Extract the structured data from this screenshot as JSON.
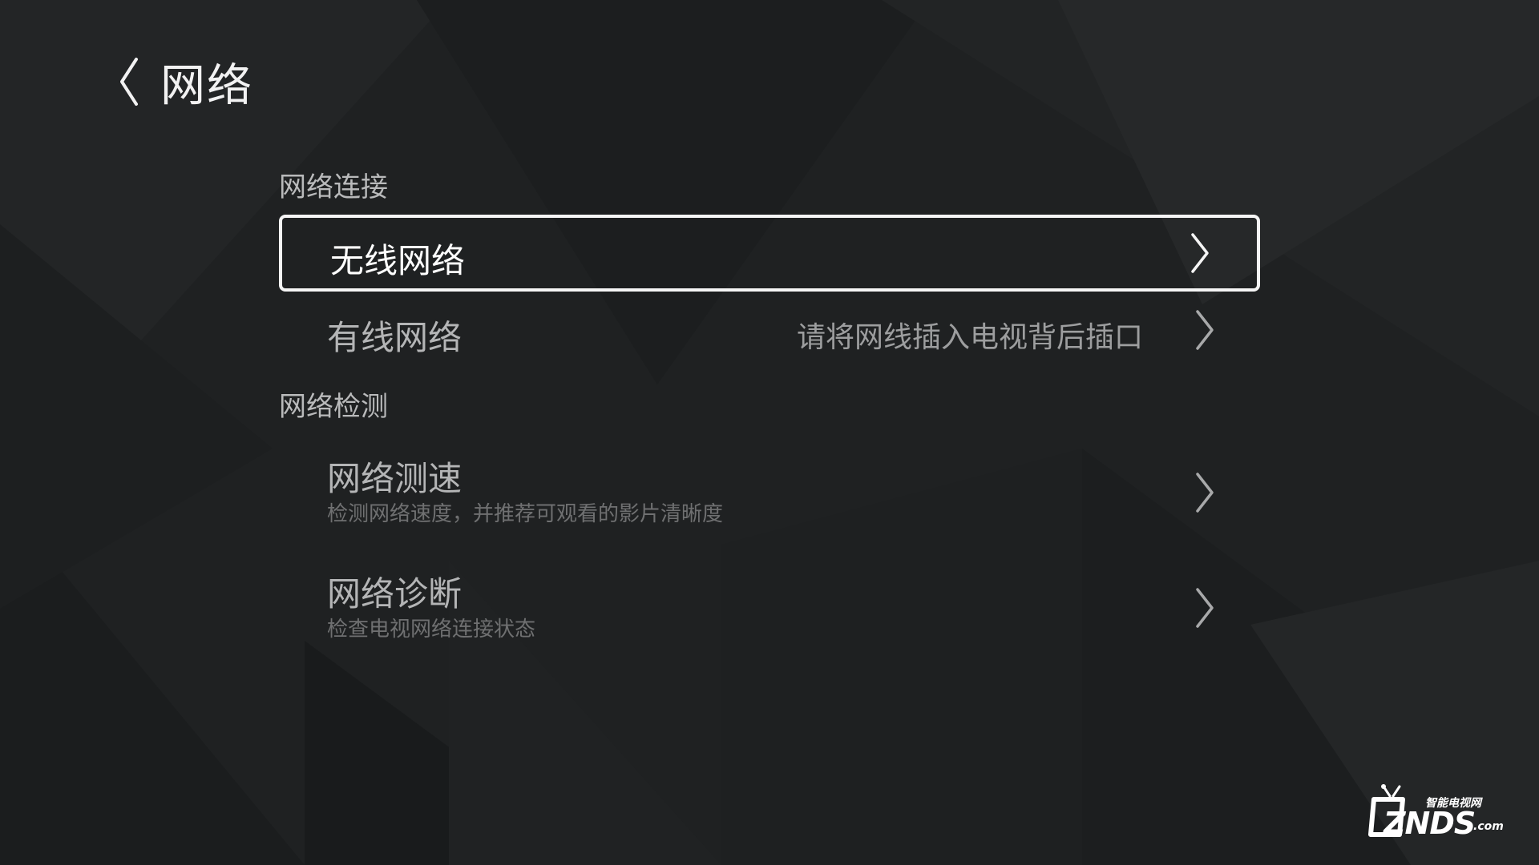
{
  "page": {
    "title": "网络",
    "back_icon": "chevron-left-icon"
  },
  "sections": [
    {
      "title": "网络连接",
      "items": [
        {
          "label": "无线网络",
          "hint": "",
          "focused": true,
          "icon": "chevron-right-icon"
        },
        {
          "label": "有线网络",
          "hint": "请将网线插入电视背后插口",
          "focused": false,
          "icon": "chevron-right-icon"
        }
      ]
    },
    {
      "title": "网络检测",
      "items": [
        {
          "label": "网络测速",
          "desc": "检测网络速度，并推荐可观看的影片清晰度",
          "focused": false,
          "icon": "chevron-right-icon"
        },
        {
          "label": "网络诊断",
          "desc": "检查电视网络连接状态",
          "focused": false,
          "icon": "chevron-right-icon"
        }
      ]
    }
  ],
  "watermark": {
    "cn": "智能电视网",
    "main": "ZNDS",
    "suffix": ".com"
  },
  "colors": {
    "background": "#1f2122",
    "focus_border": "#f5f5f5",
    "text_primary": "#ffffff",
    "text_secondary": "#b4b5b6",
    "text_muted": "#6f7071"
  }
}
